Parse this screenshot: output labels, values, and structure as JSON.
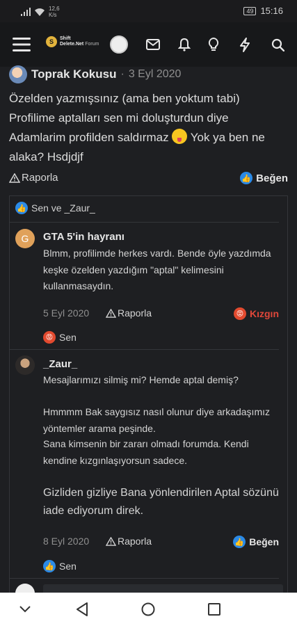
{
  "status_bar": {
    "network_speed_value": "12,6",
    "network_speed_unit": "K/s",
    "battery": "49",
    "time": "15:16"
  },
  "app": {
    "logo_line1": "Shift",
    "logo_line2": "Delete.Net",
    "logo_line3": "Forum",
    "icons": [
      "menu-icon",
      "mail-icon",
      "bell-icon",
      "lightbulb-icon",
      "bolt-icon",
      "search-icon"
    ]
  },
  "post": {
    "author": "Toprak Kokusu",
    "separator": "·",
    "date": "3 Eyl 2020",
    "body_part1": "Özelden yazmışsınız (ama ben yoktum tabi) Profilime aptalları sen mi doluşturdun diye Adamlarim profilden saldırmaz ",
    "body_part2": " Yok ya ben ne alaka? Hsdjdjf",
    "report_label": "Raporla",
    "like_label": "Beğen",
    "reactors": "Sen ve _Zaur_"
  },
  "comments": [
    {
      "avatar_letter": "G",
      "name": "GTA 5'in hayranı",
      "text": "Blmm, profilimde herkes vardı. Bende öyle yazdımda keşke özelden yazdığım \"aptal\" kelimesini kullanmasaydın.",
      "date": "5 Eyl 2020",
      "report_label": "Raporla",
      "reaction_label": "Kızgın",
      "reactors": "Sen"
    },
    {
      "name": "_Zaur_",
      "text_lines": [
        "Mesajlarımızı silmiş mi? Hemde aptal demiş?",
        "Hmmmm Bak saygısız nasıl olunur diye arkadaşımız yöntemler arama peşinde.",
        "Sana kimsenin bir zararı olmadı forumda. Kendi kendine kızgınlaşıyorsun sadece."
      ],
      "text_big": "Gizliden gizliye Bana yönlendirilen Aptal sözünü iade ediyorum direk.",
      "date": "8 Eyl 2020",
      "report_label": "Raporla",
      "reaction_label": "Beğen",
      "reactors": "Sen"
    }
  ],
  "colors": {
    "like_blue": "#2b8ae6",
    "angry_red": "#e24a2f",
    "angry_text": "#e0473a",
    "avatar_g": "#e0a15a"
  }
}
